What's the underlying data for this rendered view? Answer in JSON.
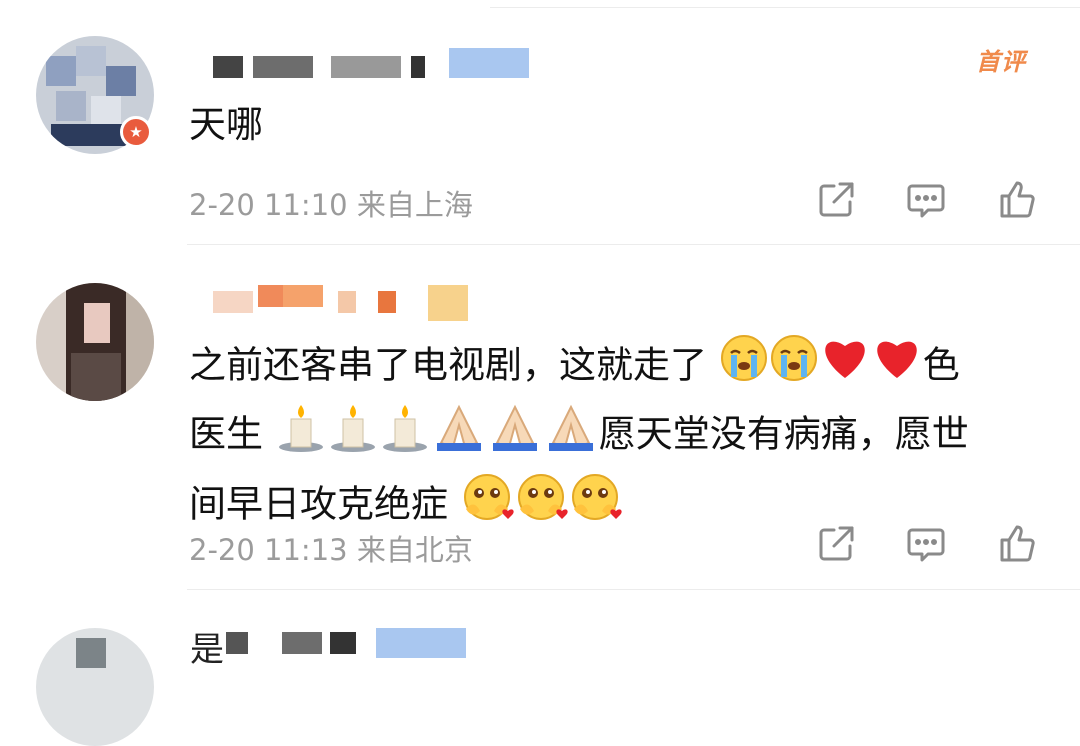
{
  "comments": [
    {
      "text": "天哪",
      "meta": "2-20 11:10 来自上海",
      "badge": "首评"
    },
    {
      "text_line1": "之前还客串了电视剧，这就走了",
      "text_after_hearts": "色",
      "text_line2_start": "医生",
      "text_line2_end": "愿天堂没有病痛，愿世",
      "text_line3": "间早日攻克绝症",
      "meta": "2-20 11:13 来自北京"
    },
    {
      "name_visible_char": "是"
    }
  ],
  "icons": {
    "share": "share-icon",
    "comment": "comment-icon",
    "like": "like-icon",
    "crying": "crying-emoji",
    "heart": "heart-emoji",
    "candle": "candle-emoji",
    "pray": "pray-emoji",
    "pleading": "pleading-emoji"
  },
  "colors": {
    "badge": "#f08a4b",
    "meta_text": "#9b9b9b",
    "verified": "#e95b3d"
  }
}
